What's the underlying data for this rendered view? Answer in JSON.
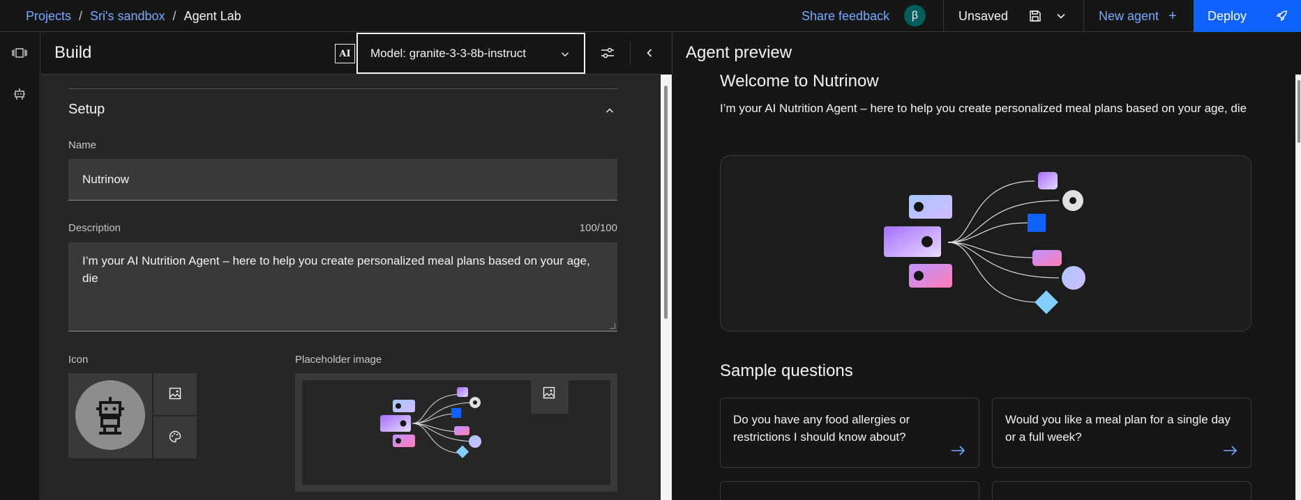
{
  "breadcrumb": {
    "items": [
      "Projects",
      "Sri's sandbox"
    ],
    "separator": "/",
    "current": "Agent Lab"
  },
  "header": {
    "feedback_label": "Share feedback",
    "beta_badge": "β",
    "save_status": "Unsaved",
    "new_agent_label": "New agent",
    "new_agent_plus": "+",
    "deploy_label": "Deploy"
  },
  "rail": {
    "icons": [
      "agent-flow-icon",
      "bot-icon"
    ]
  },
  "build": {
    "title": "Build",
    "ai_badge": "AI",
    "model_label": "Model: granite-3-3-8b-instruct",
    "setup_title": "Setup",
    "name_label": "Name",
    "name_value": "Nutrinow",
    "description_label": "Description",
    "description_counter": "100/100",
    "description_value": "I’m your AI Nutrition Agent – here to help you create personalized meal plans based on your age, die",
    "icon_label": "Icon",
    "placeholder_label": "Placeholder image"
  },
  "preview": {
    "title": "Agent preview",
    "welcome": "Welcome to Nutrinow",
    "intro": "I’m your AI Nutrition Agent – here to help you create personalized meal plans based on your age, die",
    "sample_title": "Sample questions",
    "questions": [
      "Do you have any food allergies or restrictions I should know about?",
      "Would you like a meal plan for a single day or a full week?"
    ]
  },
  "colors": {
    "accent": "#0f62fe",
    "link": "#78a9ff",
    "beta": "#005d5d"
  }
}
